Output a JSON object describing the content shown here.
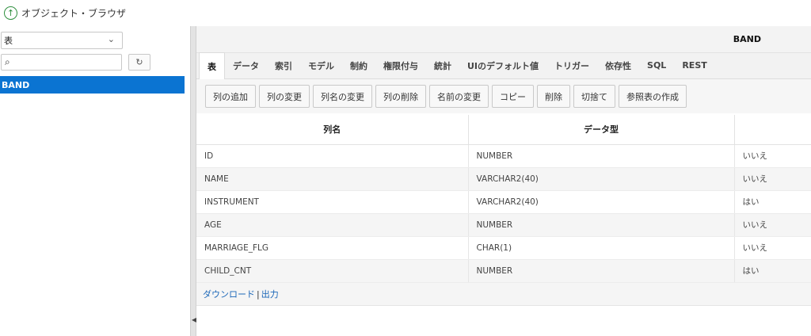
{
  "header": {
    "title": "オブジェクト・ブラウザ",
    "up_icon": "up-arrow-circle-icon"
  },
  "sidebar": {
    "object_type": "表",
    "search_value": "",
    "items": [
      {
        "label": "BAND",
        "selected": true
      }
    ]
  },
  "main": {
    "object_name": "BAND",
    "tabs": [
      {
        "label": "表",
        "active": true
      },
      {
        "label": "データ"
      },
      {
        "label": "索引"
      },
      {
        "label": "モデル"
      },
      {
        "label": "制約"
      },
      {
        "label": "権限付与"
      },
      {
        "label": "統計"
      },
      {
        "label": "UIのデフォルト値"
      },
      {
        "label": "トリガー"
      },
      {
        "label": "依存性"
      },
      {
        "label": "SQL"
      },
      {
        "label": "REST"
      }
    ],
    "toolbar": [
      "列の追加",
      "列の変更",
      "列名の変更",
      "列の削除",
      "名前の変更",
      "コピー",
      "削除",
      "切捨て",
      "参照表の作成"
    ],
    "table": {
      "columns": [
        "列名",
        "データ型",
        ""
      ],
      "rows": [
        [
          "ID",
          "NUMBER",
          "いいえ"
        ],
        [
          "NAME",
          "VARCHAR2(40)",
          "いいえ"
        ],
        [
          "INSTRUMENT",
          "VARCHAR2(40)",
          "はい"
        ],
        [
          "AGE",
          "NUMBER",
          "いいえ"
        ],
        [
          "MARRIAGE_FLG",
          "CHAR(1)",
          "いいえ"
        ],
        [
          "CHILD_CNT",
          "NUMBER",
          "はい"
        ]
      ]
    },
    "footer": {
      "download": "ダウンロード",
      "separator": "|",
      "output": "出力"
    }
  },
  "colors": {
    "accent": "#0b74d2",
    "link": "#1a66b8",
    "up_icon": "#2f8f3e"
  }
}
